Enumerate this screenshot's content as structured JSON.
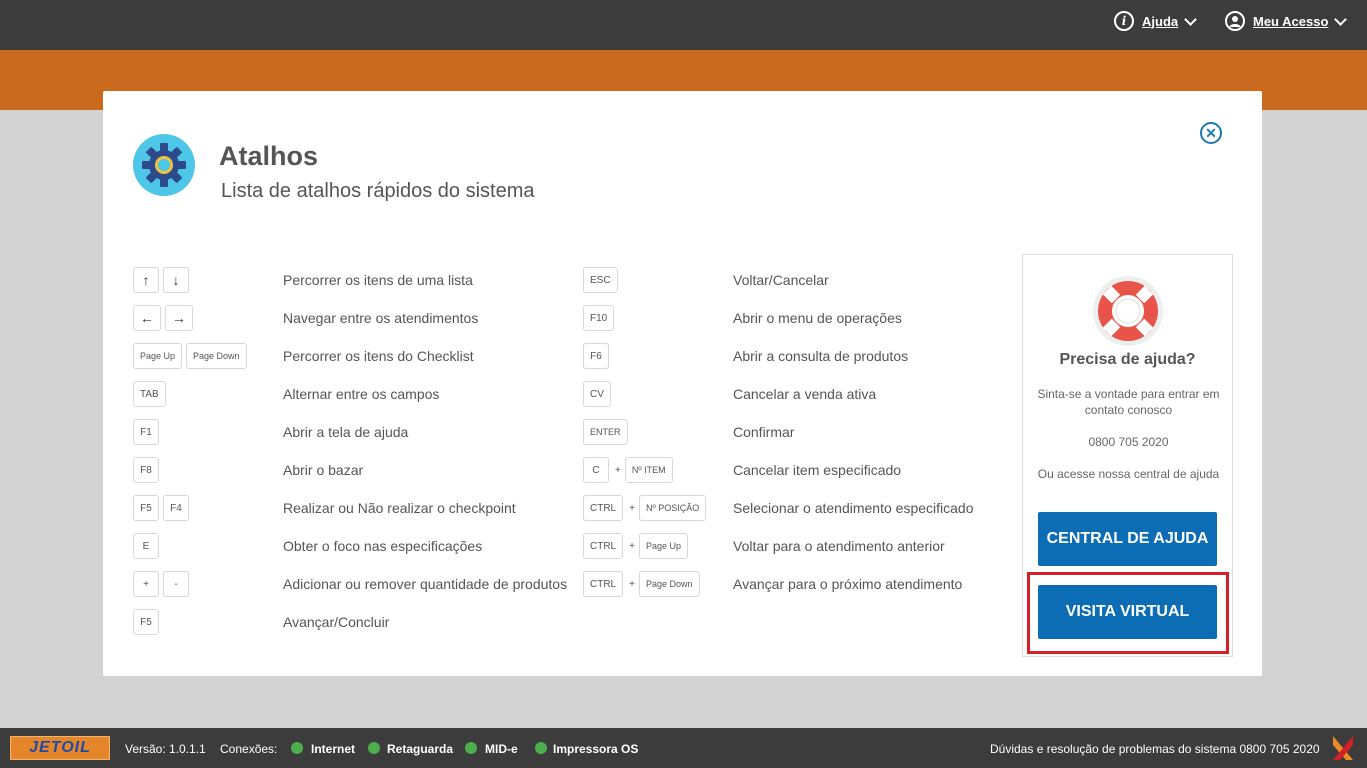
{
  "header": {
    "help_label": "Ajuda",
    "account_label": "Meu Acesso"
  },
  "modal": {
    "title": "Atalhos",
    "subtitle": "Lista de atalhos rápidos do sistema",
    "close_icon": "close-icon"
  },
  "shortcuts_left": [
    {
      "keys": [
        "↑",
        "↓"
      ],
      "desc": "Percorrer os itens de uma lista"
    },
    {
      "keys": [
        "←",
        "→"
      ],
      "desc": "Navegar entre os atendimentos"
    },
    {
      "keys": [
        "Page Up",
        "Page Down"
      ],
      "desc": "Percorrer os itens do Checklist"
    },
    {
      "keys": [
        "TAB"
      ],
      "desc": "Alternar entre os campos"
    },
    {
      "keys": [
        "F1"
      ],
      "desc": "Abrir a tela de ajuda"
    },
    {
      "keys": [
        "F8"
      ],
      "desc": "Abrir o bazar"
    },
    {
      "keys": [
        "F5",
        "F4"
      ],
      "desc": "Realizar ou Não realizar o checkpoint"
    },
    {
      "keys": [
        "E"
      ],
      "desc": "Obter o foco nas especificações"
    },
    {
      "keys": [
        "+",
        "-"
      ],
      "desc": "Adicionar ou remover quantidade de produtos"
    },
    {
      "keys": [
        "F5"
      ],
      "desc": "Avançar/Concluir"
    }
  ],
  "shortcuts_right": [
    {
      "keys": [
        "ESC"
      ],
      "desc": "Voltar/Cancelar"
    },
    {
      "keys": [
        "F10"
      ],
      "desc": "Abrir o menu de operações"
    },
    {
      "keys": [
        "F6"
      ],
      "desc": "Abrir a consulta de produtos"
    },
    {
      "keys": [
        "CV"
      ],
      "desc": "Cancelar a venda ativa"
    },
    {
      "keys": [
        "ENTER"
      ],
      "desc": "Confirmar"
    },
    {
      "keys": [
        "C",
        "Nº ITEM"
      ],
      "combo": true,
      "desc": "Cancelar item especificado"
    },
    {
      "keys": [
        "CTRL",
        "Nº POSIÇÃO"
      ],
      "combo": true,
      "desc": "Selecionar o atendimento especificado"
    },
    {
      "keys": [
        "CTRL",
        "Page Up"
      ],
      "combo": true,
      "desc": "Voltar para o atendimento anterior"
    },
    {
      "keys": [
        "CTRL",
        "Page Down"
      ],
      "combo": true,
      "desc": "Avançar para o próximo atendimento"
    }
  ],
  "combo_symbol": "+",
  "help_panel": {
    "title": "Precisa de ajuda?",
    "text1": "Sinta-se a vontade para entrar em contato conosco",
    "phone": "0800 705 2020",
    "text2": "Ou acesse nossa central de ajuda",
    "btn_central": "CENTRAL DE AJUDA",
    "btn_visita": "VISITA VIRTUAL"
  },
  "footer": {
    "logo": "JETOIL",
    "version": "Versão: 1.0.1.1",
    "connections_label": "Conexões:",
    "connections": [
      "Internet",
      "Retaguarda",
      "MID-e",
      "Impressora OS"
    ],
    "support": "Dúvidas e resolução de problemas do sistema 0800 705 2020"
  },
  "colors": {
    "orange": "#c96a1e",
    "dark": "#3c3c3c",
    "button": "#0c6db5",
    "status_ok": "#4cae4c",
    "highlight": "#d5202a"
  }
}
